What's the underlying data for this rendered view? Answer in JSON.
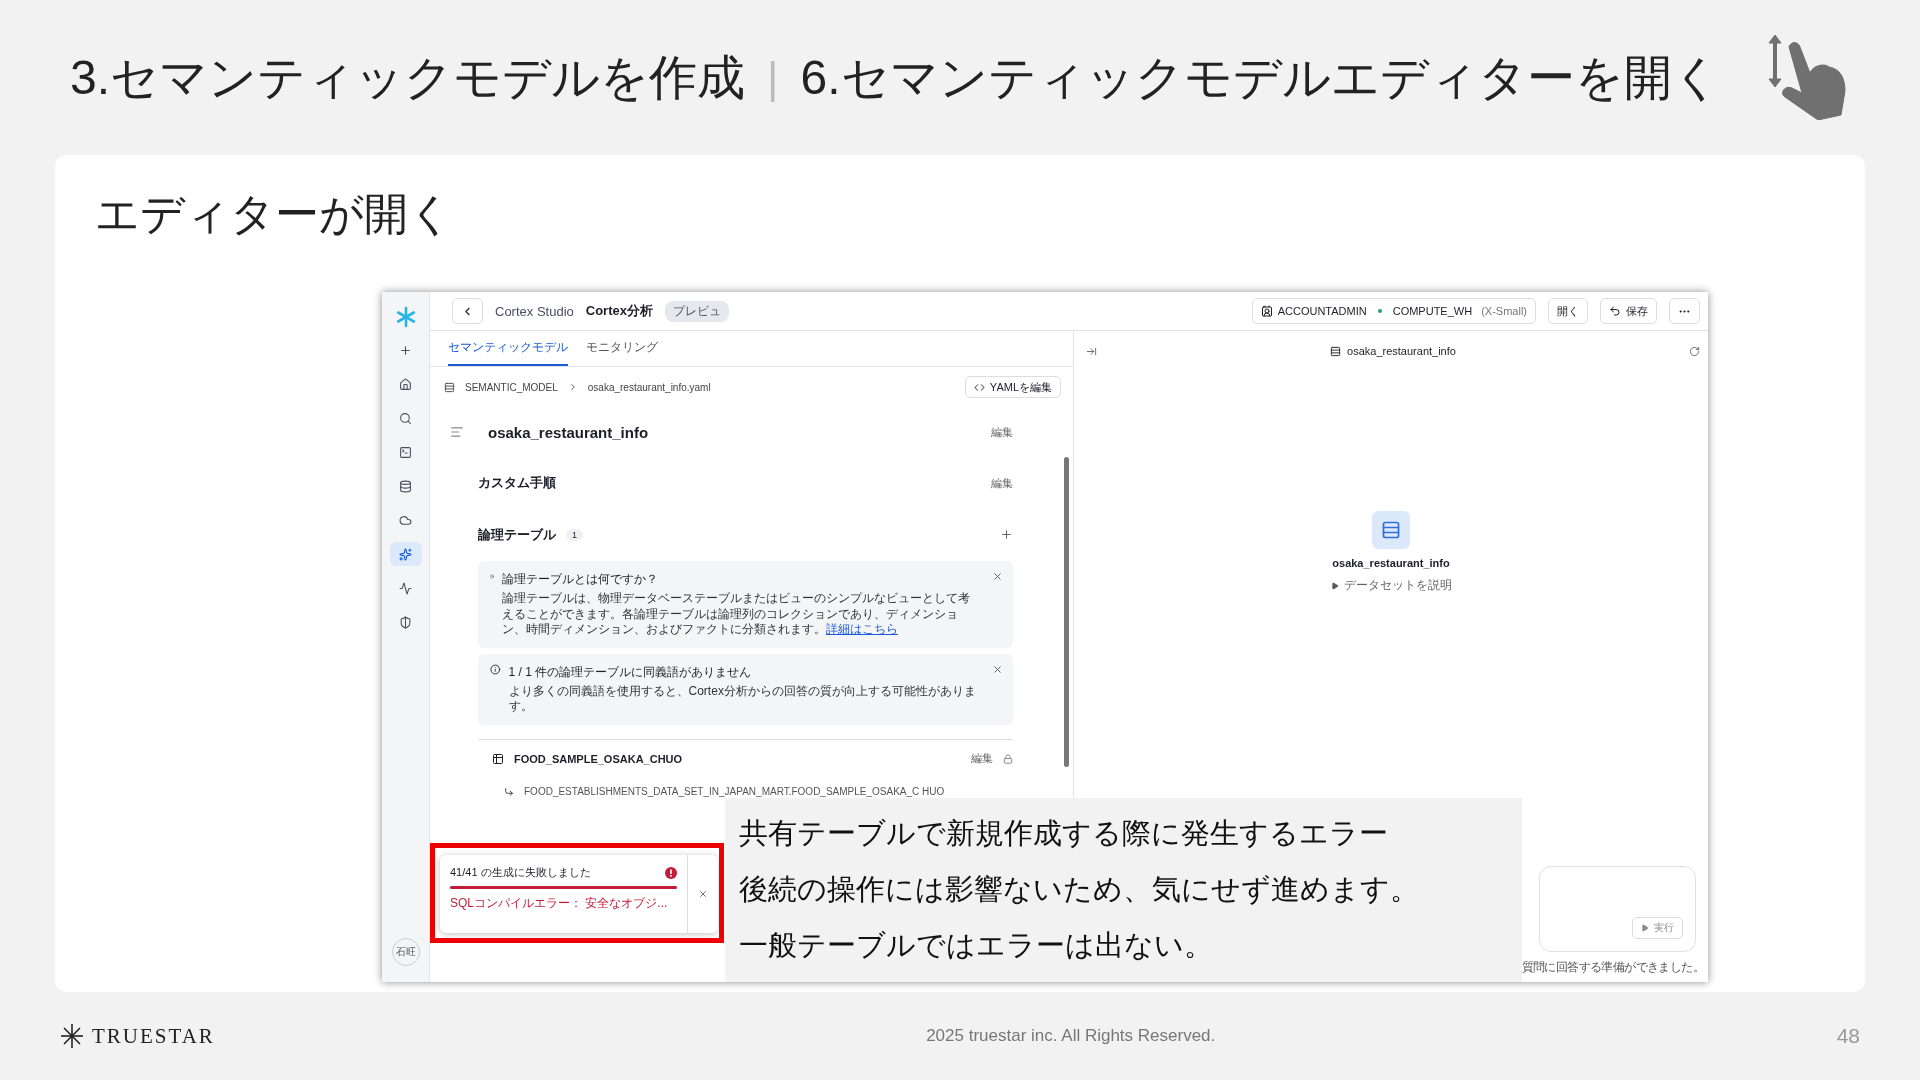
{
  "slide": {
    "title_left": "3.セマンティックモデルを作成",
    "separator": "|",
    "title_right": "6.セマンティックモデルエディターを開く",
    "heading": "エディターが開く"
  },
  "app": {
    "sidebar": {
      "items": [
        {
          "kind": "plus",
          "selected": false
        },
        {
          "kind": "home",
          "selected": false
        },
        {
          "kind": "search",
          "selected": false
        },
        {
          "kind": "terminal",
          "selected": false
        },
        {
          "kind": "database",
          "selected": false
        },
        {
          "kind": "cloud",
          "selected": false
        },
        {
          "kind": "ai",
          "selected": true
        },
        {
          "kind": "activity",
          "selected": false
        },
        {
          "kind": "shield",
          "selected": false
        }
      ],
      "avatar": "石旺"
    },
    "topbar": {
      "crumb": "Cortex Studio",
      "page": "Cortex分析",
      "badge": "プレビュ",
      "role": "ACCOUNTADMIN",
      "warehouse": "COMPUTE_WH",
      "size": "(X-Small)",
      "buttons": [
        {
          "kind": "text",
          "label": "開く"
        },
        {
          "kind": "save",
          "label": "保存"
        },
        {
          "kind": "more"
        }
      ]
    },
    "tabs": [
      {
        "label": "セマンティックモデル",
        "selected": true
      },
      {
        "label": "モニタリング",
        "selected": false
      }
    ],
    "breadcrumb": [
      "SEMANTIC_MODEL",
      "osaka_restaurant_info.yaml"
    ],
    "yaml_button": "YAMLを編集",
    "model_name": "osaka_restaurant_info",
    "model_edit": "編集",
    "custom": "カスタム手順",
    "custom_edit": "編集",
    "logical": {
      "title": "論理テーブル",
      "count": "1"
    },
    "notices": [
      {
        "title": "論理テーブルとは何ですか？",
        "body": "論理テーブルは、物理データベーステーブルまたはビューのシンプルなビューとして考えることができます。各論理テーブルは論理列のコレクションであり、ディメンション、時間ディメンション、およびファクトに分類されます。",
        "link": "詳細はこちら"
      },
      {
        "title": "1 / 1 件の論理テーブルに同義語がありません",
        "body": "より多くの同義語を使用すると、Cortex分析からの回答の質が向上する可能性があります。"
      }
    ],
    "table": {
      "name": "FOOD_SAMPLE_OSAKA_CHUO",
      "edit": "編集",
      "source": "FOOD_ESTABLISHMENTS_DATA_SET_IN_JAPAN_MART.FOOD_SAMPLE_OSAKA_C HUO"
    },
    "toast": {
      "title": "41/41 の生成に失敗しました",
      "level": 1,
      "message": "SQLコンパイルエラー： 安全なオブジ..."
    },
    "right": {
      "title": "osaka_restaurant_info",
      "name": "osaka_restaurant_info",
      "describe": "データセットを説明",
      "run": "実行",
      "status": "質問に回答する準備ができました。"
    }
  },
  "note": [
    "共有テーブルで新規作成する際に発生するエラー",
    "後続の操作には影響ないため、気にせず進めます。",
    "一般テーブルではエラーは出ない。"
  ],
  "footer": {
    "logo": "TRUESTAR",
    "copyright": "2025 truestar inc. All Rights Reserved.",
    "page": "48"
  }
}
